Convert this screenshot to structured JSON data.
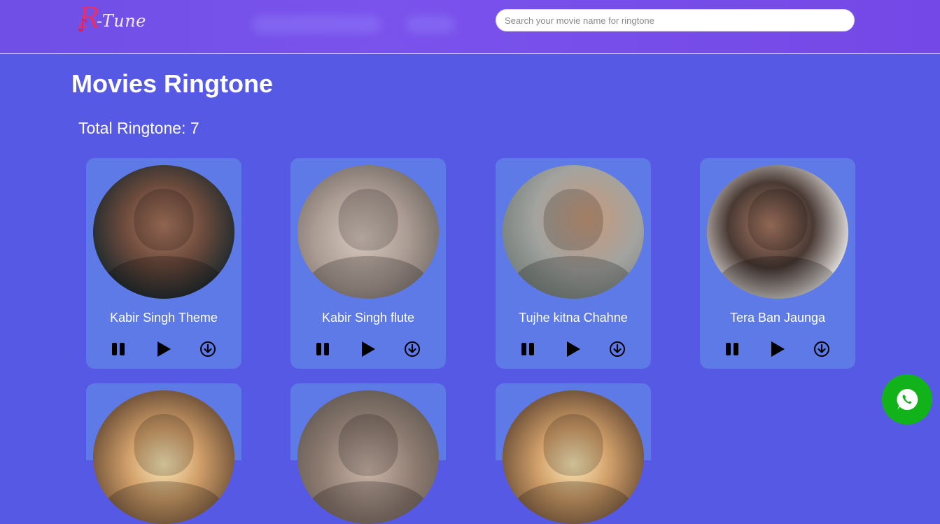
{
  "header": {
    "logo_letter": "R",
    "logo_text": "-Tune",
    "search": {
      "placeholder": "Search your movie name for ringtone",
      "value": ""
    }
  },
  "main": {
    "title": "Movies Ringtone",
    "total_label": "Total Ringtone: 7"
  },
  "ringtones": [
    {
      "title": "Kabir Singh Theme"
    },
    {
      "title": "Kabir Singh flute"
    },
    {
      "title": "Tujhe kitna Chahne"
    },
    {
      "title": "Tera Ban Jaunga"
    },
    {
      "title": ""
    },
    {
      "title": ""
    },
    {
      "title": ""
    }
  ],
  "colors": {
    "header": "#7448e6",
    "background": "#5659e3",
    "card": "#5d7ae6",
    "whatsapp": "#12b31a"
  },
  "icons": {
    "pause": "pause-icon",
    "play": "play-icon",
    "download": "download-icon",
    "whatsapp": "whatsapp-icon",
    "logo_note": "music-note-icon"
  }
}
